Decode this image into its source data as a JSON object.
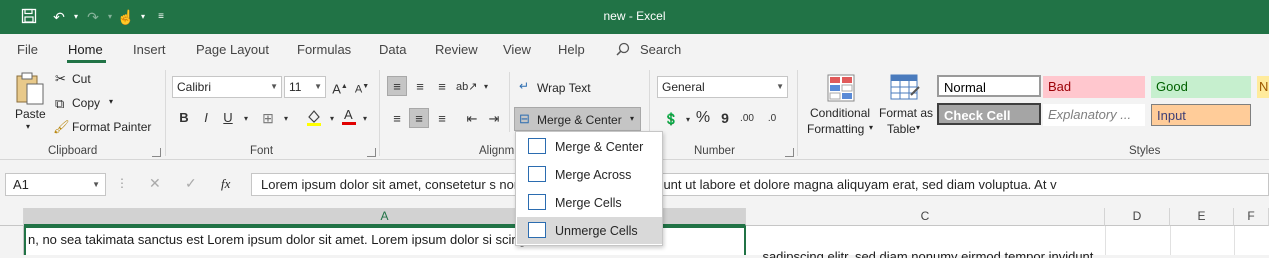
{
  "title_bar": {
    "title": "new  -  Excel"
  },
  "tabs": [
    "File",
    "Home",
    "Insert",
    "Page Layout",
    "Formulas",
    "Data",
    "Review",
    "View",
    "Help"
  ],
  "search_label": "Search",
  "clipboard": {
    "paste": "Paste",
    "cut": "Cut",
    "copy": "Copy",
    "format_painter": "Format Painter",
    "group_label": "Clipboard"
  },
  "font": {
    "name": "Calibri",
    "size": "11",
    "bold": "B",
    "italic": "I",
    "underline": "U",
    "group_label": "Font"
  },
  "alignment": {
    "wrap_text": "Wrap Text",
    "merge_center": "Merge & Center",
    "group_label": "Alignm"
  },
  "number": {
    "format": "General",
    "percent": "%",
    "comma": "9",
    "group_label": "Number"
  },
  "styles": {
    "conditional_formatting": [
      "Conditional",
      "Formatting"
    ],
    "format_as_table": [
      "Format as",
      "Table"
    ],
    "cells": [
      {
        "label": "Normal",
        "bg": "#ffffff",
        "fg": "#000000"
      },
      {
        "label": "Bad",
        "bg": "#ffc7ce",
        "fg": "#9c0006"
      },
      {
        "label": "Good",
        "bg": "#c6efce",
        "fg": "#006100"
      },
      {
        "label": "N",
        "bg": "#ffeb9c",
        "fg": "#9c5700"
      },
      {
        "label": "Check Cell",
        "bg": "#a5a5a5",
        "fg": "#ffffff"
      },
      {
        "label": "Explanatory ...",
        "bg": "#ffffff",
        "fg": "#7f7f7f"
      },
      {
        "label": "Input",
        "bg": "#ffcc99",
        "fg": "#3f3f76"
      }
    ],
    "group_label": "Styles"
  },
  "merge_menu": {
    "items": [
      "Merge & Center",
      "Merge Across",
      "Merge Cells",
      "Unmerge Cells"
    ],
    "hover_index": 3
  },
  "formula_bar": {
    "name_box": "A1",
    "fx": "fx",
    "content": "Lorem ipsum dolor sit amet, consetetur s                                                                     nonumy eirmod tempor invidunt ut labore et dolore magna aliquyam erat, sed diam voluptua. At v"
  },
  "grid": {
    "columns": [
      "A",
      "C",
      "D",
      "E",
      "F"
    ],
    "a1_text": "n, no sea takimata sanctus est Lorem ipsum dolor sit amet. Lorem ipsum dolor si                              scing elitr, se",
    "c_overflow_text": "... sadipscing elitr, sed diam nonumy eirmod tempor invidunt"
  },
  "colors": {
    "accent": "#217346"
  }
}
